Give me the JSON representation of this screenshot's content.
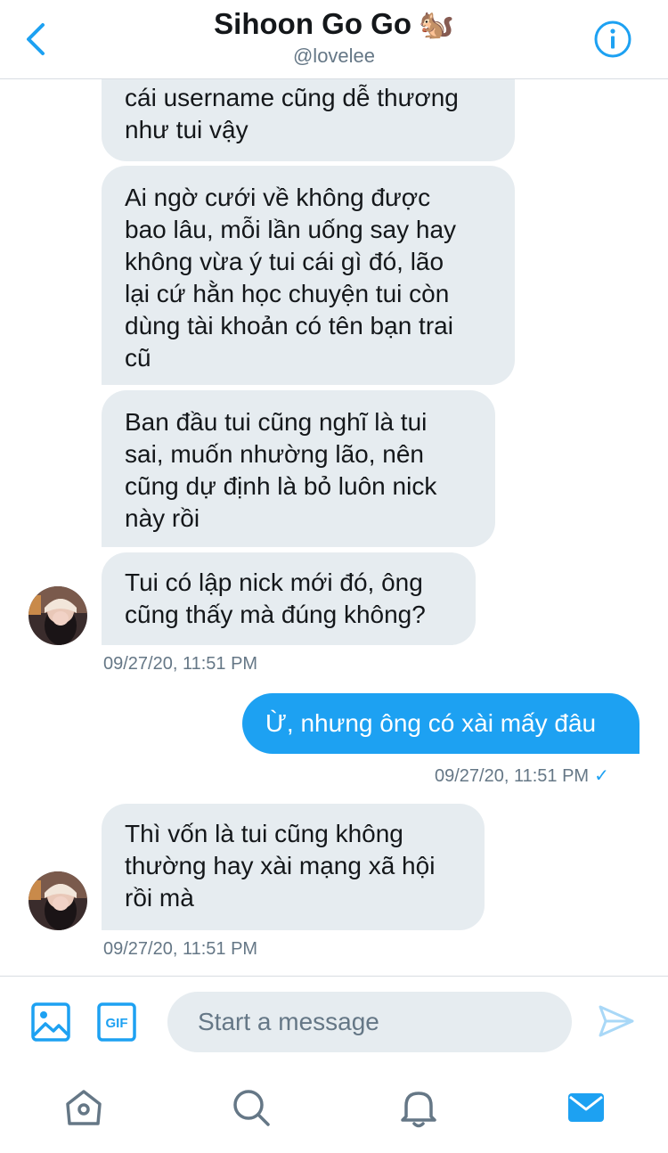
{
  "header": {
    "back_icon": "chevron-left-icon",
    "title": "Sihoon Go Go",
    "title_emoji": "🐿️",
    "handle": "@lovelee",
    "info_icon": "info-icon"
  },
  "messages": [
    {
      "from": "them",
      "lines": [
        "cái username cũng dễ thương",
        "như tui vậy"
      ]
    },
    {
      "from": "them",
      "lines": [
        "Ai ngờ cưới về không được",
        "bao lâu, mỗi lần uống say hay",
        "không vừa ý tui cái gì đó, lão",
        "lại cứ hằn học chuyện tui còn",
        "dùng tài khoản có tên bạn trai",
        "cũ"
      ]
    },
    {
      "from": "them",
      "lines": [
        "Ban đầu tui cũng nghĩ là tui",
        "sai, muốn nhường lão, nên",
        "cũng dự định là bỏ luôn nick",
        "này rồi"
      ]
    },
    {
      "from": "them",
      "lines": [
        "Tui có lập nick mới đó, ông",
        "cũng thấy mà đúng không?"
      ]
    },
    {
      "from": "me",
      "lines": [
        "Ừ, nhưng ông có xài mấy đâu"
      ]
    },
    {
      "from": "them",
      "lines": [
        "Thì vốn là tui cũng không",
        "thường hay xài mạng xã hội",
        "rồi mà"
      ]
    }
  ],
  "timestamps": {
    "t1": "09/27/20, 11:51 PM",
    "t2": "09/27/20, 11:51 PM",
    "t3": "09/27/20, 11:51 PM",
    "t2_check": "✓"
  },
  "composer": {
    "image_icon": "image-icon",
    "gif_label": "GIF",
    "placeholder": "Start a message",
    "send_icon": "send-icon"
  },
  "tabbar": {
    "items": [
      "home-icon",
      "search-icon",
      "notifications-icon",
      "messages-icon"
    ],
    "active": "messages-icon"
  },
  "colors": {
    "accent": "#1da1f2",
    "bubble_them": "#e6ecf0",
    "secondary_text": "#657786"
  }
}
